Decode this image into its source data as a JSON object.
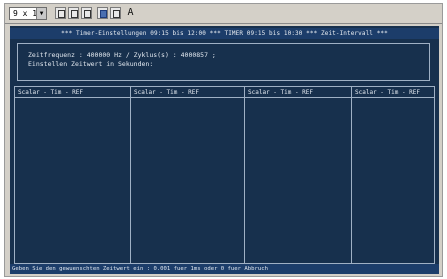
{
  "toolbar": {
    "font_select_value": "9 x 1",
    "buttons": [
      "toolbar-button-1",
      "toolbar-button-2",
      "toolbar-button-3",
      "toolbar-button-4",
      "toolbar-button-5"
    ],
    "glyph_label": "A"
  },
  "console": {
    "title": "*** Timer-Einstellungen 09:15 bis 12:00 *** TIMER 09:15 bis 10:30 *** Zeit-Intervall ***",
    "info_line_1": "Zeitfrequenz : 400000 Hz  /  Zyklus(s) :   4000857 ;",
    "info_line_2": "  Einstellen Zeitwert in Sekunden:",
    "columns": [
      {
        "header": "Scalar - Tim - REF"
      },
      {
        "header": "Scalar - Tim - REF"
      },
      {
        "header": "Scalar - Tim - REF"
      },
      {
        "header": "Scalar - Tim - REF"
      }
    ],
    "status": "Geben Sie den gewuenschten Zeitwert ein : 0.001 fuer 1ms oder 0 fuer Abbruch"
  },
  "colors": {
    "console_bg": "#17304d",
    "title_bar_bg": "#1c3d6a",
    "console_text": "#dfe6ee",
    "window_chrome": "#d4d0c8"
  }
}
